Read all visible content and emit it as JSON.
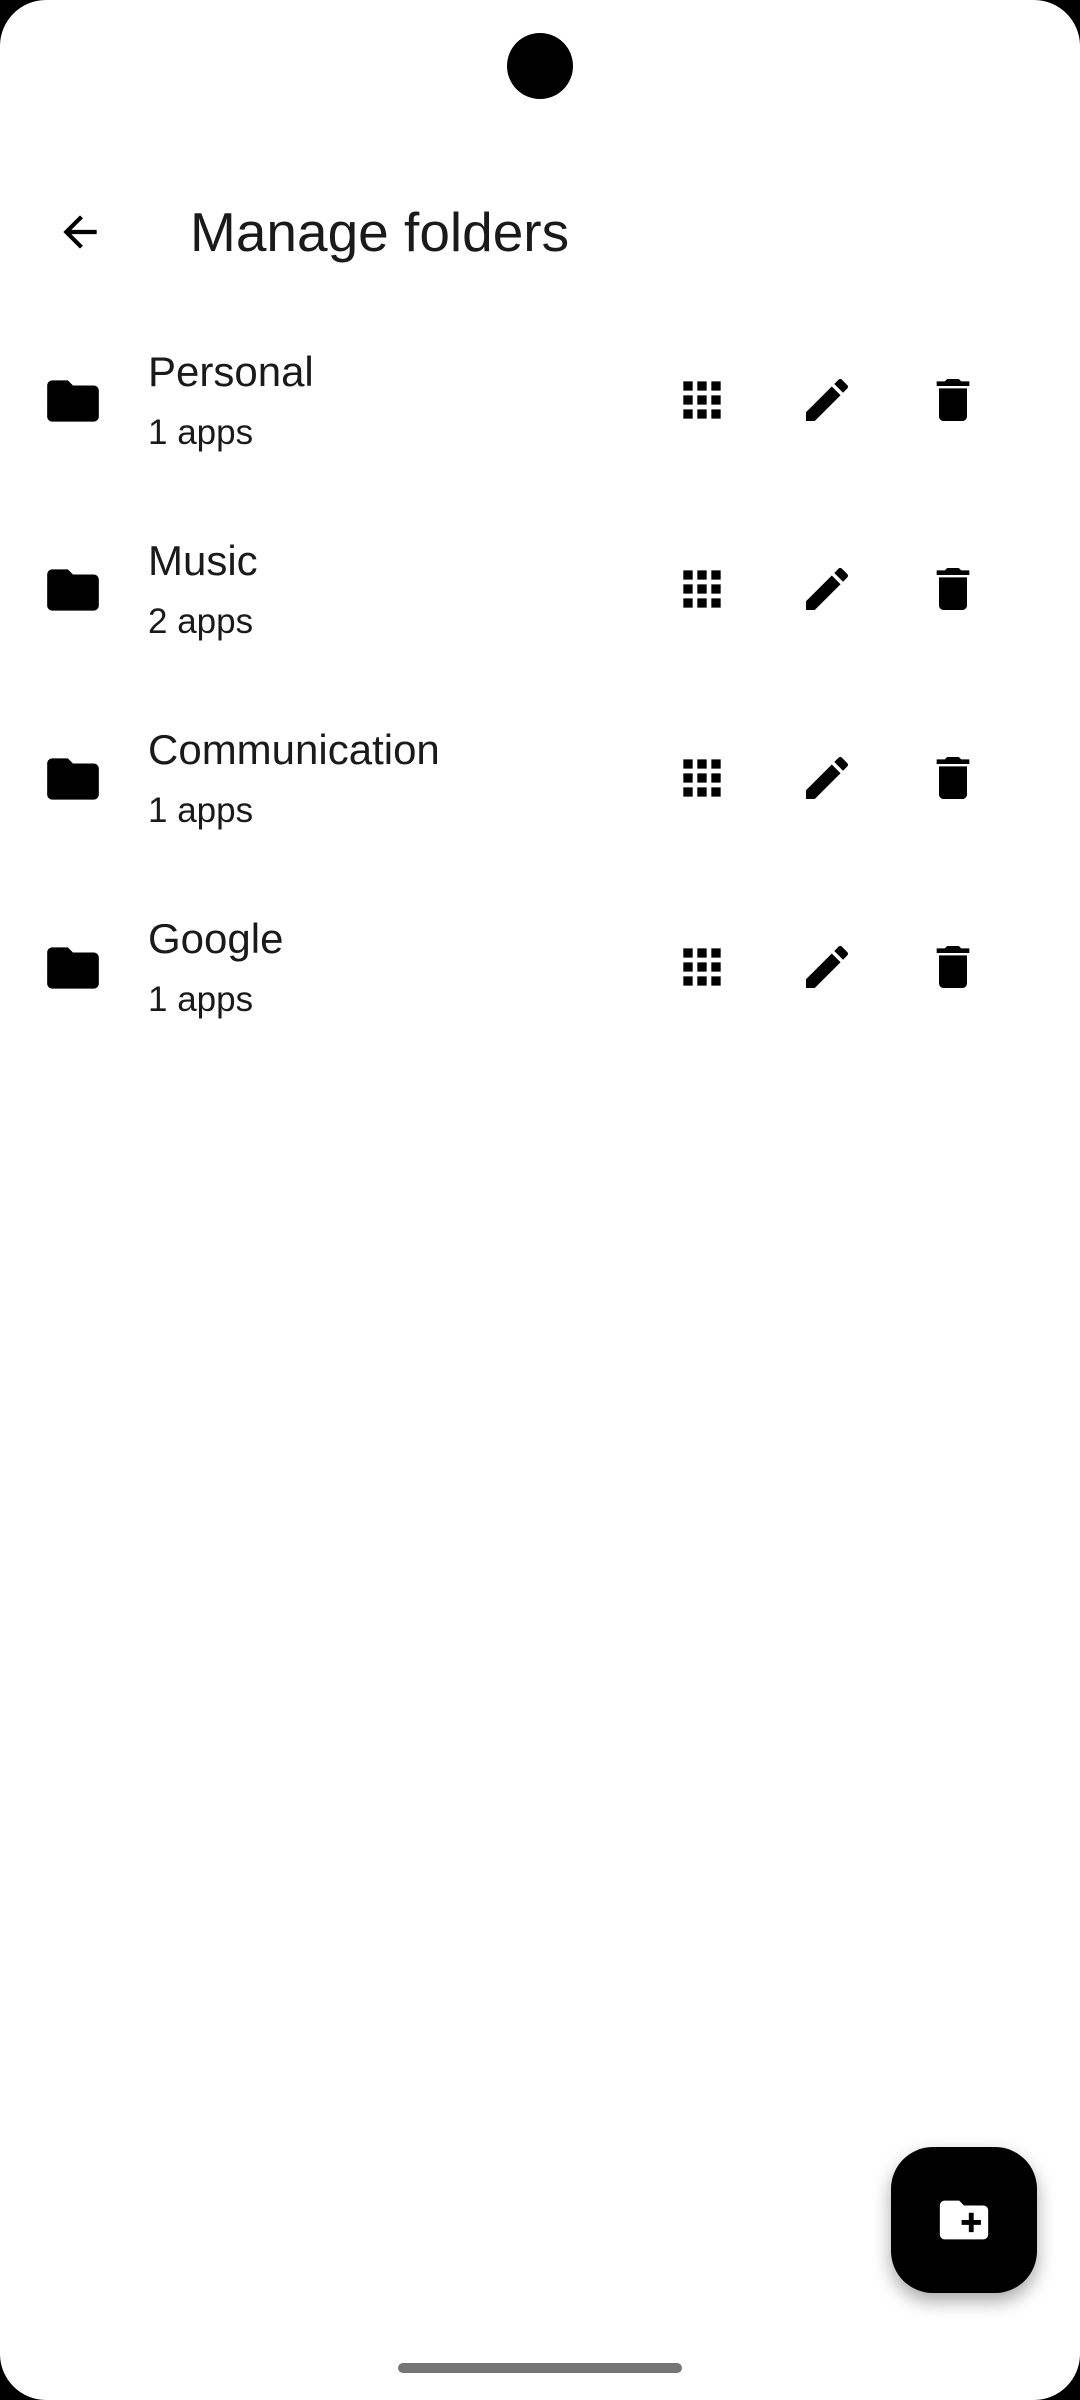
{
  "header": {
    "title": "Manage folders",
    "back_icon": "arrow-back-icon"
  },
  "folders": [
    {
      "name": "Personal",
      "count": "1 apps"
    },
    {
      "name": "Music",
      "count": "2 apps"
    },
    {
      "name": "Communication",
      "count": "1 apps"
    },
    {
      "name": "Google",
      "count": "1 apps"
    }
  ],
  "row_actions": {
    "apps_icon": "apps-grid-icon",
    "edit_icon": "pencil-icon",
    "delete_icon": "trash-icon",
    "folder_icon": "folder-icon"
  },
  "fab": {
    "icon": "create-new-folder-icon"
  },
  "colors": {
    "background": "#ffffff",
    "foreground": "#000000",
    "fab": "#000000",
    "gesture_bar": "#757575"
  }
}
